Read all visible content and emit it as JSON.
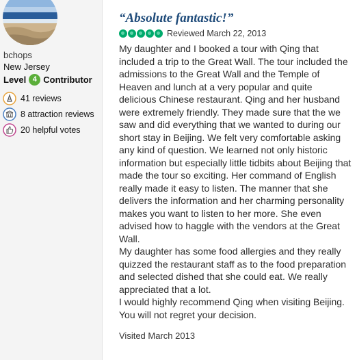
{
  "reviewer": {
    "username": "bchops",
    "location": "New Jersey",
    "level_word": "Level",
    "level_number": "4",
    "level_title": "Contributor",
    "stats": [
      {
        "icon": "pen-icon",
        "text": "41 reviews"
      },
      {
        "icon": "attraction-icon",
        "text": "8 attraction reviews"
      },
      {
        "icon": "thumbs-up-icon",
        "text": "20 helpful votes"
      }
    ]
  },
  "review": {
    "title": "“Absolute fantastic!”",
    "rating": 5,
    "rating_max": 5,
    "reviewed_date": "Reviewed March 22, 2013",
    "paragraphs": [
      "My daughter and I booked a tour with Qing that included a trip to the Great Wall. The tour included the admissions to the Great Wall and the Temple of Heaven and lunch at a very popular and quite delicious Chinese restaurant. Qing and her husband were extremely friendly. They made sure that the we saw and did everything that we wanted to during our short stay in Beijing. We felt very comfortable asking any kind of question. We learned not only historic information but especially little tidbits about Beijing that made the tour so exciting. Her command of English really made it easy to listen. The manner that she delivers the information and her charming personality makes you want to listen to her more. She even advised how to haggle with the vendors at the Great Wall.",
      "My daughter has some food allergies and they really quizzed the restaurant staff as to the food preparation and selected dished that she could eat. We really appreciated that a lot.",
      "I would highly recommend Qing when visiting Beijing. You will not regret your decision."
    ],
    "visited": "Visited March 2013"
  },
  "colors": {
    "title": "#1f4b7a",
    "bubble": "#00aa6c",
    "level_badge": "#5bae3a"
  }
}
